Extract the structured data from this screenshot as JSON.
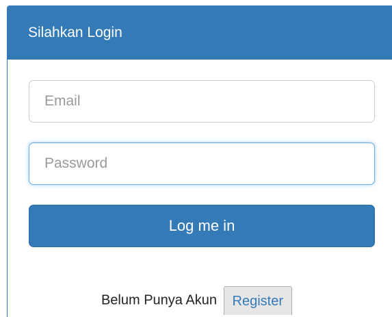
{
  "panel": {
    "title": "Silahkan Login"
  },
  "form": {
    "email": {
      "placeholder": "Email",
      "value": ""
    },
    "password": {
      "placeholder": "Password",
      "value": ""
    },
    "submit_label": "Log me in"
  },
  "register": {
    "prompt": "Belum Punya Akun",
    "button_label": "Register"
  },
  "colors": {
    "primary": "#337ab7",
    "focus_border": "#66afe9",
    "register_bg": "#e6e6e6"
  }
}
